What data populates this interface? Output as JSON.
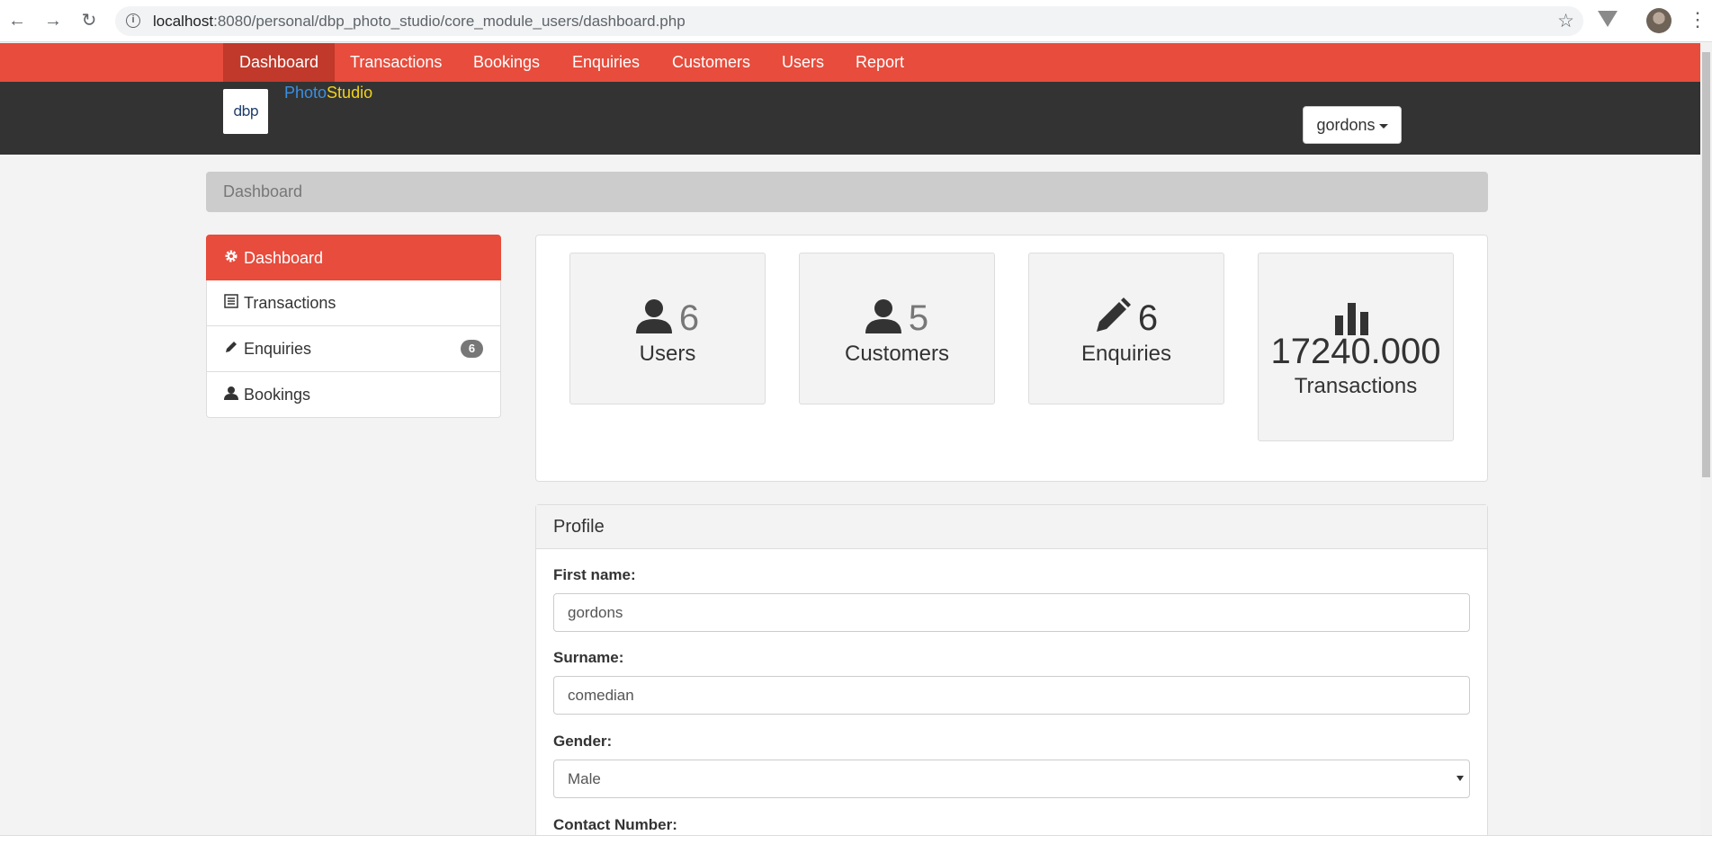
{
  "browser": {
    "url_host": "localhost",
    "url_path": ":8080/personal/dbp_photo_studio/core_module_users/dashboard.php"
  },
  "topnav": {
    "items": [
      "Dashboard",
      "Transactions",
      "Bookings",
      "Enquiries",
      "Customers",
      "Users",
      "Report"
    ],
    "active": "Dashboard"
  },
  "header": {
    "logo_text": "dbp",
    "brand_part1": "Photo",
    "brand_part2": "Studio",
    "user_button": "gordons"
  },
  "breadcrumb": "Dashboard",
  "sidebar": {
    "items": [
      {
        "label": "Dashboard",
        "icon": "gear-icon"
      },
      {
        "label": "Transactions",
        "icon": "list-icon"
      },
      {
        "label": "Enquiries",
        "icon": "pencil-icon",
        "badge": "6"
      },
      {
        "label": "Bookings",
        "icon": "user-icon"
      }
    ]
  },
  "stats": [
    {
      "value": "6",
      "label": "Users",
      "icon": "user-icon"
    },
    {
      "value": "5",
      "label": "Customers",
      "icon": "user-icon"
    },
    {
      "value": "6",
      "label": "Enquiries",
      "icon": "pencil-icon"
    },
    {
      "value": "17240.000",
      "label": "Transactions",
      "icon": "bar-chart-icon"
    }
  ],
  "profile": {
    "title": "Profile",
    "first_name_label": "First name:",
    "first_name_value": "gordons",
    "surname_label": "Surname:",
    "surname_value": "comedian",
    "gender_label": "Gender:",
    "gender_value": "Male",
    "contact_label": "Contact Number:"
  }
}
